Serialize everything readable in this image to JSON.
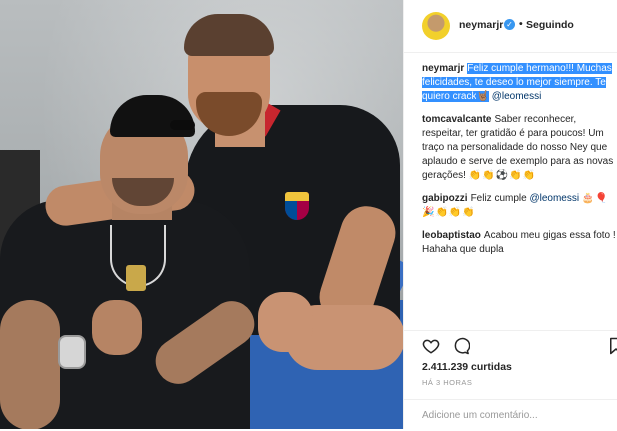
{
  "post": {
    "author": {
      "username": "neymarjr",
      "verified_icon": "verified-badge-icon",
      "follow_status": "Seguindo"
    },
    "comments": [
      {
        "user": "neymarjr",
        "text": "Feliz cumple hermano!!! Muchas felicidades, te deseo lo mejor siempre. Te quiero crack",
        "emoji": "🤘🏽",
        "mention": "@leomessi",
        "highlighted": true
      },
      {
        "user": "tomcavalcante",
        "text": "Saber reconhecer, respeitar, ter gratidão é para poucos! Um traço na personalidade do nosso Ney que aplaudo e serve de exemplo para as novas gerações!",
        "emoji": "👏👏⚽👏👏"
      },
      {
        "user": "gabipozzi",
        "text": "Feliz cumple",
        "mention": "@leomessi",
        "emoji": "🎂🎈🎉👏👏👏"
      },
      {
        "user": "leobaptistao",
        "text": "Acabou meu gigas essa foto ! Hahaha que dupla"
      }
    ],
    "actions": {
      "like_icon": "heart-icon",
      "comment_icon": "comment-icon",
      "save_icon": "bookmark-icon"
    },
    "likes": "2.411.239 curtidas",
    "time_ago": "HÁ 3 HORAS",
    "add_comment_placeholder": "Adicione um comentário..."
  },
  "colors": {
    "selection": "#3390ff",
    "verified": "#3897f0",
    "bench": "#2f63b3"
  }
}
